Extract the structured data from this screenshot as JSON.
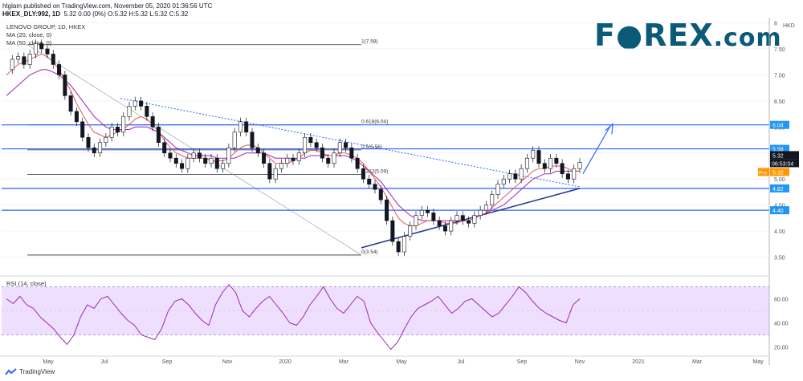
{
  "header": {
    "published": "htglam published on TradingView.com, November 05, 2020 01:36:56 UTC",
    "symbol": "HKEX_DLY:992, 1D",
    "quote": "5.32 0.00 (0%) O:5.32 H:5.32 L:5.32 C:5.32"
  },
  "overlays": {
    "title": "LENOVO GROUP, 1D, HKEX",
    "ma20": "MA (20, close, 0)",
    "ma50": "MA (50, close, 0)",
    "rsi": "RSI (14, close)"
  },
  "logo": {
    "main": "F●REX",
    "suffix": ".com"
  },
  "footer": {
    "brand": "TradingView"
  },
  "colors": {
    "candle": "#131722",
    "ma20": "#e05a5a",
    "ma50": "#9c27b0",
    "level": "#2962ff",
    "rsi": "#9c27b0",
    "rsi_band": "#efdfff",
    "price_tag": "#131722",
    "pre_tag": "#ff9800",
    "level_tag": "#2196f3"
  },
  "chart_data": {
    "type": "line",
    "currency": "HKD",
    "x_ticks": [
      "May",
      "Jul",
      "Sep",
      "Nov",
      "2020",
      "Mar",
      "May",
      "Jul",
      "Sep",
      "Nov",
      "2021",
      "Mar",
      "May"
    ],
    "y_ticks": [
      3.5,
      4.0,
      4.5,
      5.0,
      5.5,
      6.0,
      6.5,
      7.0,
      7.5,
      8.0
    ],
    "y_tick_labels": [
      "3.50",
      "4.00",
      "4.50",
      "5.00",
      "5.50",
      "6.00",
      "6.50",
      "7.00",
      "7.50",
      "8"
    ],
    "ylim": [
      3.2,
      8.1
    ],
    "close_series": [
      7.1,
      7.3,
      7.35,
      7.2,
      7.4,
      7.6,
      7.5,
      7.4,
      7.2,
      7.0,
      6.6,
      6.3,
      6.1,
      5.8,
      5.6,
      5.5,
      5.7,
      5.8,
      6.0,
      5.9,
      6.2,
      6.4,
      6.5,
      6.4,
      6.2,
      6.0,
      5.7,
      5.5,
      5.4,
      5.3,
      5.2,
      5.4,
      5.5,
      5.4,
      5.3,
      5.4,
      5.2,
      5.3,
      5.6,
      5.9,
      6.1,
      5.9,
      5.6,
      5.5,
      5.3,
      5.0,
      5.2,
      5.3,
      5.4,
      5.35,
      5.5,
      5.8,
      5.7,
      5.6,
      5.4,
      5.3,
      5.5,
      5.7,
      5.6,
      5.4,
      5.2,
      5.0,
      4.9,
      4.8,
      4.6,
      4.2,
      3.8,
      3.6,
      3.9,
      4.1,
      4.3,
      4.4,
      4.35,
      4.2,
      4.1,
      4.0,
      4.2,
      4.3,
      4.2,
      4.15,
      4.3,
      4.4,
      4.5,
      4.7,
      4.9,
      5.0,
      5.1,
      5.0,
      5.2,
      5.4,
      5.55,
      5.3,
      5.2,
      5.4,
      5.3,
      5.1,
      5.0,
      5.2,
      5.32
    ],
    "ma20_series": [
      7.0,
      7.1,
      7.2,
      7.25,
      7.3,
      7.35,
      7.4,
      7.35,
      7.25,
      7.1,
      6.9,
      6.7,
      6.45,
      6.25,
      6.05,
      5.9,
      5.85,
      5.8,
      5.85,
      5.9,
      5.95,
      6.05,
      6.15,
      6.2,
      6.15,
      6.05,
      5.9,
      5.75,
      5.6,
      5.5,
      5.45,
      5.4,
      5.4,
      5.4,
      5.4,
      5.35,
      5.35,
      5.35,
      5.4,
      5.5,
      5.6,
      5.65,
      5.65,
      5.6,
      5.5,
      5.4,
      5.3,
      5.3,
      5.3,
      5.35,
      5.4,
      5.5,
      5.55,
      5.55,
      5.5,
      5.45,
      5.45,
      5.5,
      5.5,
      5.45,
      5.4,
      5.3,
      5.15,
      5.0,
      4.85,
      4.65,
      4.45,
      4.25,
      4.15,
      4.1,
      4.1,
      4.15,
      4.2,
      4.2,
      4.2,
      4.15,
      4.15,
      4.15,
      4.2,
      4.2,
      4.25,
      4.3,
      4.35,
      4.45,
      4.55,
      4.65,
      4.75,
      4.85,
      4.95,
      5.05,
      5.15,
      5.2,
      5.2,
      5.25,
      5.25,
      5.25,
      5.2,
      5.15,
      5.15
    ],
    "ma50_series": [
      6.6,
      6.7,
      6.8,
      6.9,
      7.0,
      7.05,
      7.1,
      7.1,
      7.05,
      7.0,
      6.9,
      6.8,
      6.65,
      6.5,
      6.35,
      6.2,
      6.1,
      6.0,
      5.95,
      5.95,
      5.95,
      5.95,
      6.0,
      6.0,
      6.0,
      5.95,
      5.9,
      5.8,
      5.7,
      5.6,
      5.55,
      5.5,
      5.45,
      5.45,
      5.45,
      5.45,
      5.4,
      5.4,
      5.4,
      5.4,
      5.45,
      5.5,
      5.5,
      5.5,
      5.5,
      5.45,
      5.4,
      5.4,
      5.4,
      5.4,
      5.4,
      5.4,
      5.45,
      5.45,
      5.45,
      5.45,
      5.45,
      5.45,
      5.45,
      5.4,
      5.35,
      5.25,
      5.15,
      5.05,
      4.95,
      4.8,
      4.65,
      4.5,
      4.4,
      4.3,
      4.25,
      4.2,
      4.2,
      4.2,
      4.2,
      4.2,
      4.2,
      4.2,
      4.2,
      4.2,
      4.25,
      4.3,
      4.35,
      4.4,
      4.45,
      4.5,
      4.6,
      4.7,
      4.8,
      4.9,
      5.0,
      5.05,
      5.1,
      5.1,
      5.15,
      5.15,
      5.15,
      5.15,
      5.15
    ],
    "rsi_series": [
      60,
      56,
      62,
      55,
      52,
      45,
      40,
      35,
      28,
      22,
      30,
      45,
      55,
      52,
      60,
      62,
      55,
      48,
      42,
      38,
      30,
      28,
      26,
      35,
      50,
      58,
      60,
      55,
      48,
      42,
      38,
      55,
      65,
      72,
      65,
      50,
      45,
      52,
      58,
      62,
      55,
      48,
      40,
      38,
      45,
      55,
      62,
      70,
      60,
      52,
      48,
      55,
      62,
      58,
      40,
      32,
      25,
      18,
      24,
      35,
      45,
      52,
      55,
      58,
      62,
      55,
      48,
      52,
      58,
      60,
      55,
      50,
      45,
      48,
      55,
      62,
      70,
      65,
      58,
      52,
      48,
      45,
      42,
      40,
      55,
      60
    ],
    "rsi_ylim": [
      15,
      75
    ],
    "rsi_ticks": [
      20,
      40,
      60
    ],
    "rsi_tick_labels": [
      "20.00",
      "40.00",
      "60.00"
    ],
    "horizontal_levels": [
      {
        "value": 6.04,
        "label": "6.04"
      },
      {
        "value": 5.58,
        "label": "5.58"
      },
      {
        "value": 4.82,
        "label": "4.82"
      },
      {
        "value": 4.4,
        "label": "4.40"
      }
    ],
    "fibonacci": [
      {
        "value": 7.58,
        "label": "1(7.58)"
      },
      {
        "value": 6.04,
        "label": "0.618(6.04)"
      },
      {
        "value": 5.56,
        "label": "0.5(5.56)"
      },
      {
        "value": 5.09,
        "label": "0.382(5.09)"
      },
      {
        "value": 3.54,
        "label": "0(3.54)"
      }
    ],
    "price_tags": [
      {
        "label": "5.32",
        "kind": "last"
      },
      {
        "label": "06:53:04",
        "kind": "countdown"
      },
      {
        "label": "Pre",
        "kind": "pre"
      },
      {
        "label": "5.32",
        "kind": "pre"
      }
    ]
  }
}
